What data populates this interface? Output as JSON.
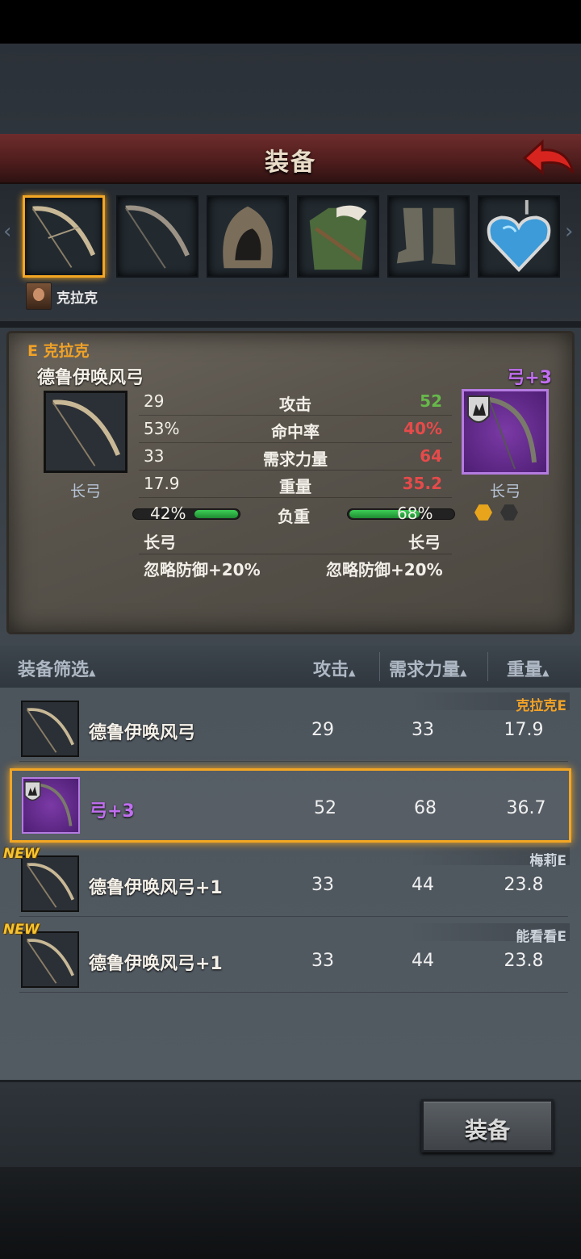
{
  "header": {
    "title": "装备"
  },
  "owner": {
    "name": "克拉克"
  },
  "compare": {
    "owner_label": "E 克拉克",
    "current_name": "德鲁伊唤风弓",
    "candidate_name": "弓+3",
    "current_type": "长弓",
    "candidate_type": "长弓",
    "stats": [
      {
        "current": "29",
        "label": "攻击",
        "candidate": "52"
      },
      {
        "current": "53%",
        "label": "命中率",
        "candidate": "40%"
      },
      {
        "current": "33",
        "label": "需求力量",
        "candidate": "64"
      },
      {
        "current": "17.9",
        "label": "重量",
        "candidate": "35.2"
      }
    ],
    "load": {
      "label": "负重",
      "current": "42%",
      "candidate": "68%",
      "current_fraction": 0.42,
      "candidate_fraction": 0.68
    },
    "traits": {
      "current_type": "长弓",
      "candidate_type": "长弓",
      "current_effect": "忽略防御+20%",
      "candidate_effect": "忽略防御+20%"
    },
    "colors": {
      "better": "#67b84a",
      "worse": "#e64a4a",
      "rare": "#c16ef0",
      "owner": "#f1a227"
    }
  },
  "list": {
    "headers": {
      "filter": "装备筛选",
      "attack": "攻击",
      "strength": "需求力量",
      "weight": "重量"
    },
    "items": [
      {
        "name": "德鲁伊唤风弓",
        "attack": "29",
        "strength": "33",
        "weight": "17.9",
        "owner": "克拉克E",
        "new": ""
      },
      {
        "name": "弓+3",
        "attack": "52",
        "strength": "68",
        "weight": "36.7",
        "owner": "",
        "new": ""
      },
      {
        "name": "德鲁伊唤风弓+1",
        "attack": "33",
        "strength": "44",
        "weight": "23.8",
        "owner": "梅莉E",
        "new": "NEW"
      },
      {
        "name": "德鲁伊唤风弓+1",
        "attack": "33",
        "strength": "44",
        "weight": "23.8",
        "owner": "能看看E",
        "new": "NEW"
      }
    ]
  },
  "footer": {
    "equip_label": "装备"
  }
}
